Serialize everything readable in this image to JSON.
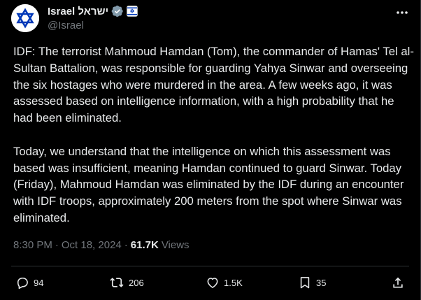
{
  "account": {
    "display_name": "Israel ישראל",
    "handle": "@Israel",
    "verified_icon": "verified-badge-icon",
    "affiliation_icon": "israel-flag-icon",
    "avatar_icon": "star-of-david-icon"
  },
  "tweet": {
    "paragraph1": "IDF: The terrorist Mahmoud Hamdan (Tom), the commander of Hamas' Tel al-Sultan Battalion, was responsible for guarding Yahya Sinwar and overseeing the six hostages who were murdered in the area. A few weeks ago, it was assessed based on intelligence information, with a high probability that he had been eliminated.",
    "paragraph2": "Today, we understand that the intelligence on which this assessment was based was insufficient, meaning Hamdan continued to guard Sinwar. Today (Friday), Mahmoud Hamdan was eliminated by the IDF during an encounter with IDF troops, approximately 200 meters from the spot where Sinwar was eliminated.",
    "time": "8:30 PM",
    "separator": "·",
    "date": "Oct 18, 2024",
    "views_count": "61.7K",
    "views_label": "Views"
  },
  "actions": {
    "replies": "94",
    "reposts": "206",
    "likes": "1.5K",
    "bookmarks": "35"
  },
  "colors": {
    "background": "#000000",
    "text": "#e7e9ea",
    "secondary": "#71767b",
    "link": "#1d9bf0",
    "verified": "#829aab"
  }
}
